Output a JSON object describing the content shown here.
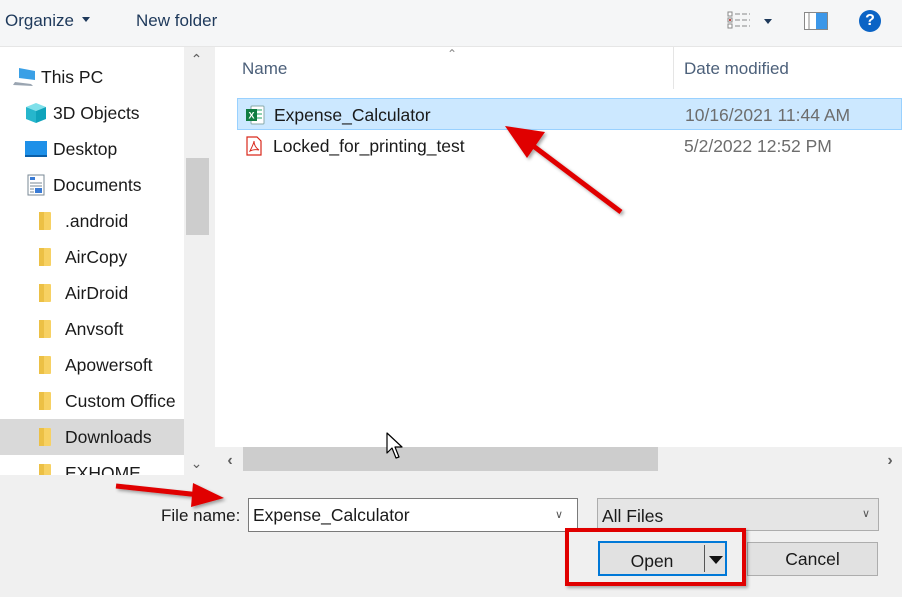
{
  "toolbar": {
    "organize_label": "Organize",
    "new_folder_label": "New folder",
    "view_icon": "details-view-icon",
    "preview_icon": "preview-pane-icon",
    "help_label": "?"
  },
  "sidebar": {
    "items": [
      {
        "label": "This PC",
        "icon": "computer-icon"
      },
      {
        "label": "3D Objects",
        "icon": "3d-objects-icon"
      },
      {
        "label": "Desktop",
        "icon": "desktop-icon"
      },
      {
        "label": "Documents",
        "icon": "documents-icon"
      },
      {
        "label": ".android",
        "icon": "folder-icon"
      },
      {
        "label": "AirCopy",
        "icon": "folder-icon"
      },
      {
        "label": "AirDroid",
        "icon": "folder-icon"
      },
      {
        "label": "Anvsoft",
        "icon": "folder-icon"
      },
      {
        "label": "Apowersoft",
        "icon": "folder-icon"
      },
      {
        "label": "Custom Office",
        "icon": "folder-icon"
      },
      {
        "label": "Downloads",
        "icon": "folder-icon",
        "selected": true
      },
      {
        "label": "EXHOME",
        "icon": "folder-icon"
      }
    ]
  },
  "filelist": {
    "columns": {
      "name": "Name",
      "date": "Date modified"
    },
    "files": [
      {
        "name": "Expense_Calculator",
        "date": "10/16/2021 11:44 AM",
        "type": "excel",
        "selected": true
      },
      {
        "name": "Locked_for_printing_test",
        "date": "5/2/2022 12:52 PM",
        "type": "pdf",
        "selected": false
      }
    ]
  },
  "footer": {
    "file_name_label": "File name:",
    "file_name_value": "Expense_Calculator",
    "file_type_value": "All Files",
    "open_label": "Open",
    "cancel_label": "Cancel"
  },
  "colors": {
    "selection_bg": "#cce8ff",
    "accent": "#0078d7",
    "annotation": "#e00000"
  }
}
